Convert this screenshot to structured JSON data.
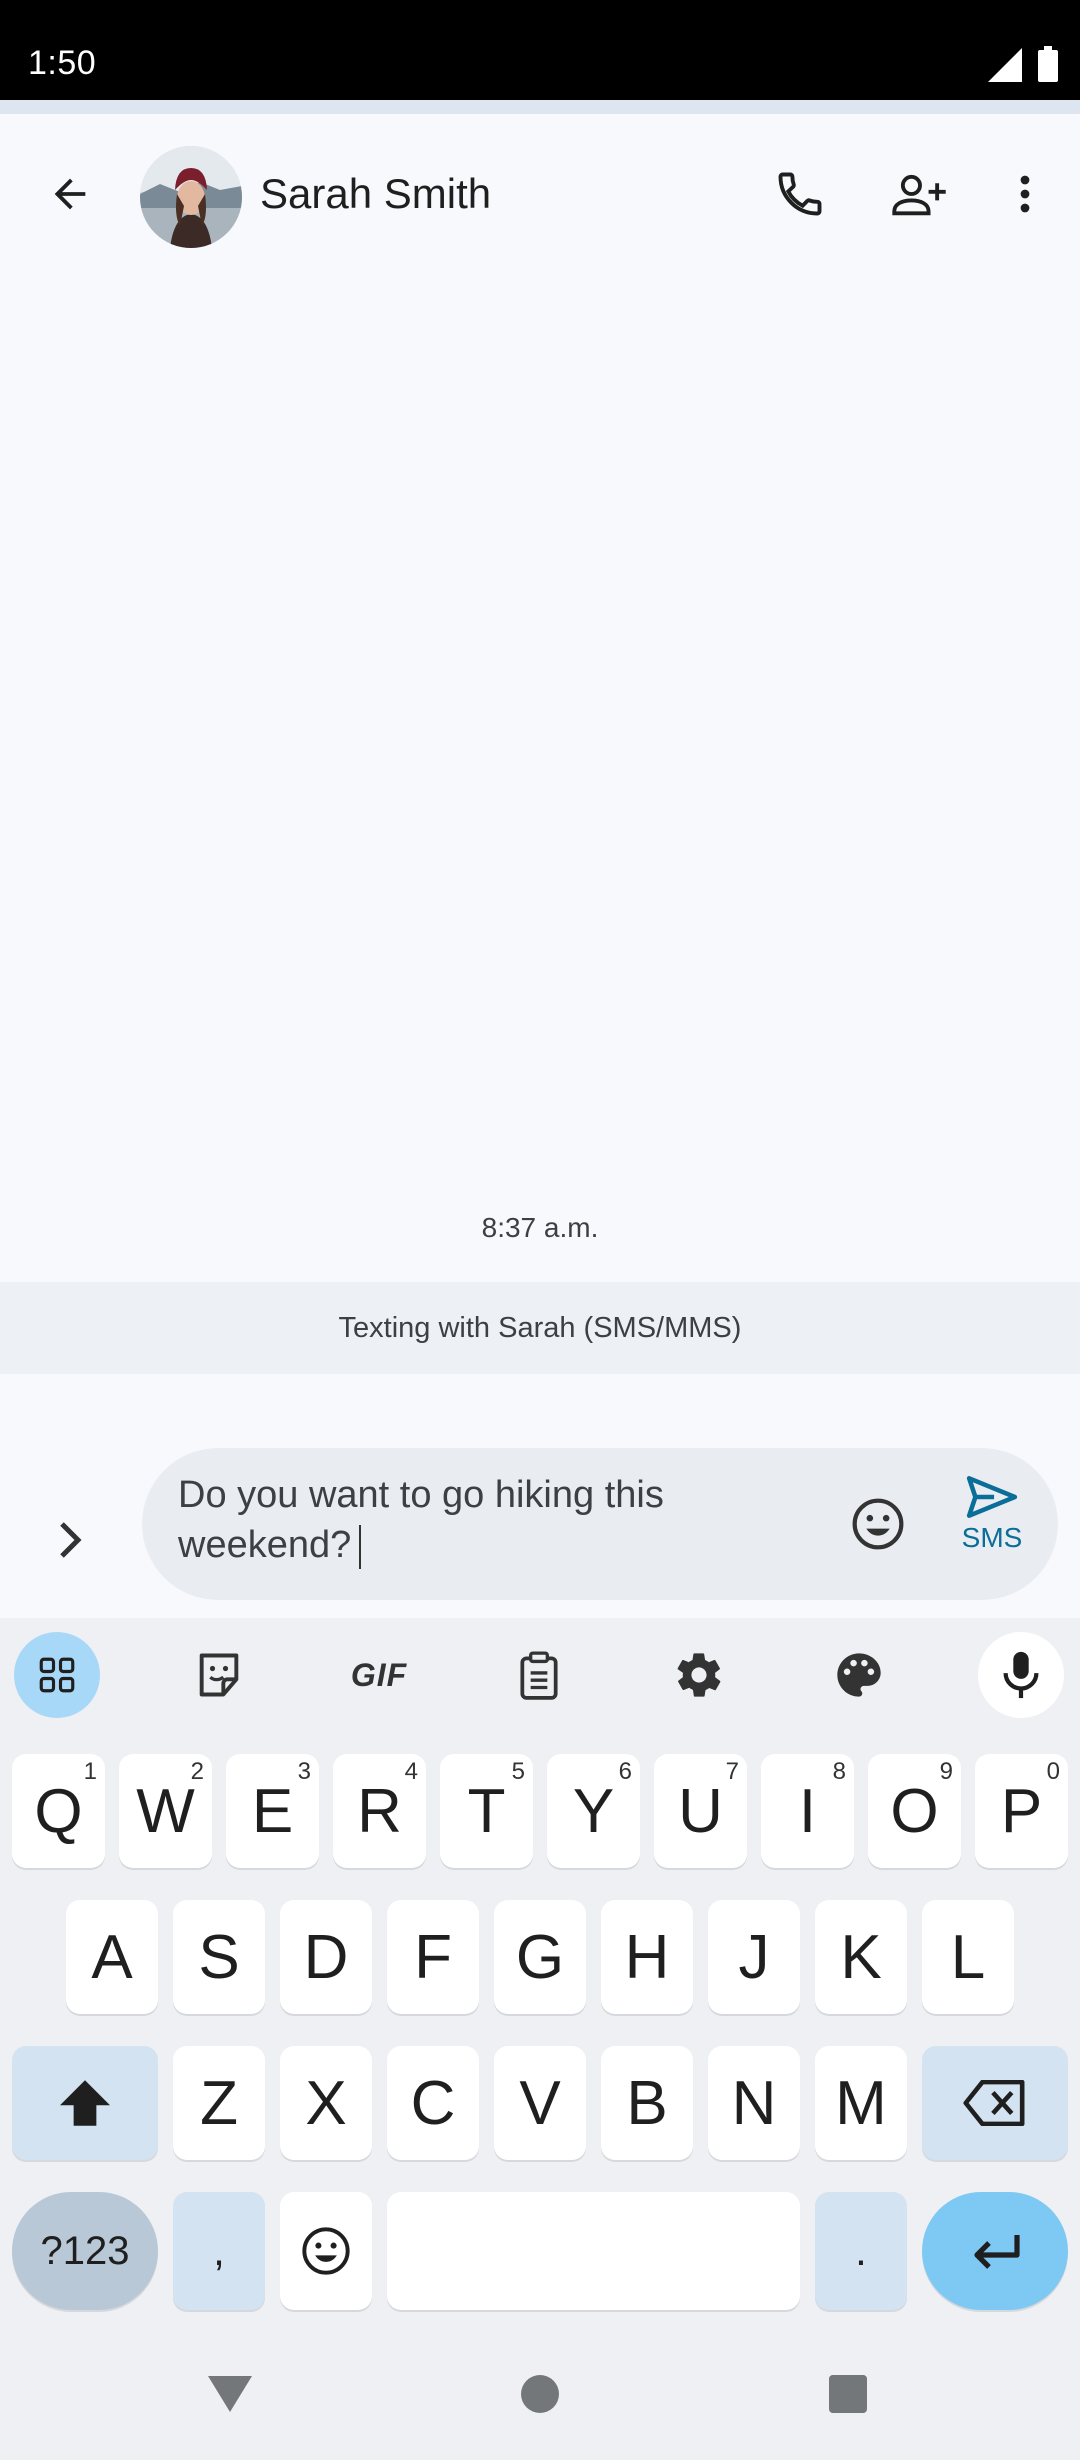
{
  "status_bar": {
    "time": "1:50"
  },
  "header": {
    "contact_name": "Sarah Smith"
  },
  "conversation": {
    "timestamp": "8:37 a.m."
  },
  "banner": {
    "text": "Texting with Sarah (SMS/MMS)"
  },
  "compose": {
    "value": "Do you want to go hiking this weekend?",
    "send_label": "SMS"
  },
  "keyboard": {
    "toolbar": {
      "gif_label": "GIF"
    },
    "row1": [
      {
        "label": "Q",
        "sup": "1"
      },
      {
        "label": "W",
        "sup": "2"
      },
      {
        "label": "E",
        "sup": "3"
      },
      {
        "label": "R",
        "sup": "4"
      },
      {
        "label": "T",
        "sup": "5"
      },
      {
        "label": "Y",
        "sup": "6"
      },
      {
        "label": "U",
        "sup": "7"
      },
      {
        "label": "I",
        "sup": "8"
      },
      {
        "label": "O",
        "sup": "9"
      },
      {
        "label": "P",
        "sup": "0"
      }
    ],
    "row2": [
      "A",
      "S",
      "D",
      "F",
      "G",
      "H",
      "J",
      "K",
      "L"
    ],
    "row3": [
      "Z",
      "X",
      "C",
      "V",
      "B",
      "N",
      "M"
    ],
    "symbols_label": "?123",
    "comma_label": ",",
    "period_label": "."
  },
  "colors": {
    "accent_blue": "#0b6e99",
    "toolbar_active": "#a8d8f8",
    "enter_key": "#7ec8f4",
    "mod_key": "#d3e3f1"
  },
  "icons": [
    "back-arrow-icon",
    "phone-icon",
    "add-person-icon",
    "more-vert-icon",
    "chevron-right-icon",
    "emoji-icon",
    "send-icon",
    "apps-grid-icon",
    "sticker-icon",
    "clipboard-icon",
    "gear-icon",
    "palette-icon",
    "mic-icon",
    "shift-icon",
    "backspace-icon",
    "enter-icon",
    "nav-back-icon",
    "nav-home-icon",
    "nav-recents-icon"
  ]
}
